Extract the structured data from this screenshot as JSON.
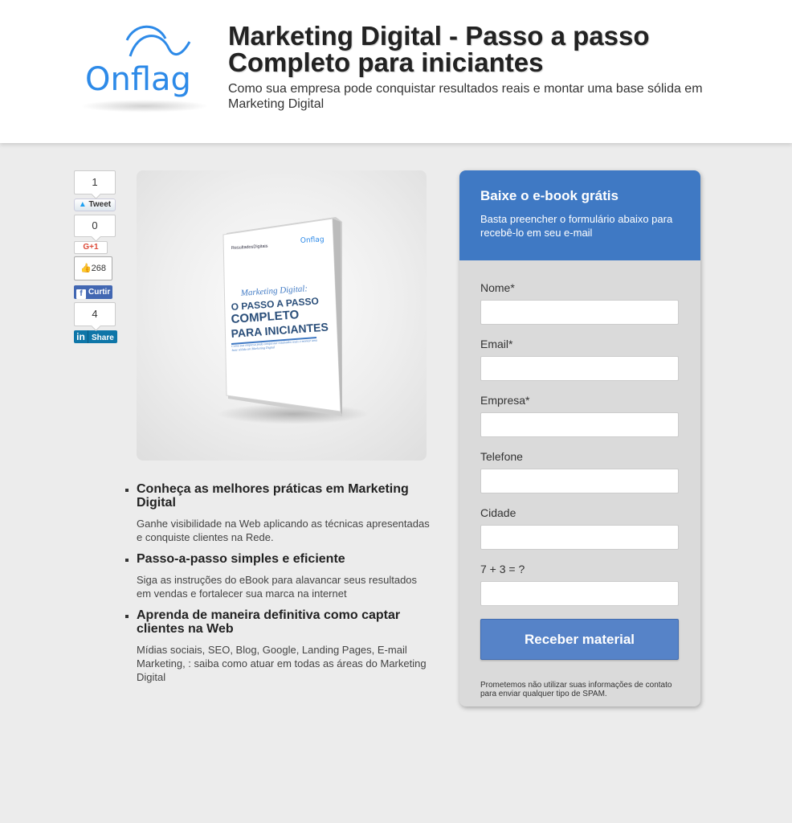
{
  "header": {
    "logo_text": "Onflag",
    "title": "Marketing Digital - Passo a passo Completo para iniciantes",
    "subtitle": "Como sua empresa pode conquistar resultados reais e montar uma base sólida em Marketing Digital"
  },
  "social": {
    "tweet_count": "1",
    "tweet_label": "Tweet",
    "gplus_count": "0",
    "gplus_label": "G+1",
    "fb_like_count": "268",
    "fb_label": "Curtir",
    "linkedin_count": "4",
    "linkedin_label": "Share"
  },
  "book": {
    "brand": "ResultadosDigitais",
    "logo": "Onflag",
    "line1": "Marketing Digital:",
    "line2": "O PASSO A PASSO",
    "line3": "COMPLETO",
    "line4": "PARA INICIANTES",
    "caption": "Como sua empresa pode conquistar resultados reais e montar uma base sólida em Marketing Digital"
  },
  "benefits": [
    {
      "title": "Conheça as melhores práticas em Marketing Digital",
      "text": "Ganhe visibilidade na Web aplicando as técnicas apresentadas e conquiste clientes na Rede."
    },
    {
      "title": "Passo-a-passo simples e eficiente",
      "text": "Siga as instruções do eBook para alavancar seus resultados em vendas e fortalecer sua marca na internet"
    },
    {
      "title": "Aprenda de maneira definitiva como captar clientes na Web",
      "text": "Mídias sociais, SEO, Blog, Google, Landing Pages, E-mail Marketing, : saiba como atuar em todas as áreas do Marketing Digital"
    }
  ],
  "form": {
    "heading": "Baixe o e-book grátis",
    "subheading": "Basta preencher o formulário abaixo para recebê-lo em seu e-mail",
    "fields": [
      {
        "label": "Nome*",
        "value": ""
      },
      {
        "label": "Email*",
        "value": ""
      },
      {
        "label": "Empresa*",
        "value": ""
      },
      {
        "label": "Telefone",
        "value": ""
      },
      {
        "label": "Cidade",
        "value": ""
      },
      {
        "label": "7 + 3 = ?",
        "value": ""
      }
    ],
    "submit_label": "Receber material",
    "disclaimer": "Prometemos não utilizar suas informações de contato para enviar qualquer tipo de SPAM."
  },
  "colors": {
    "accent": "#3f79c4",
    "button": "#5683c8",
    "logo": "#2d8ae8"
  }
}
